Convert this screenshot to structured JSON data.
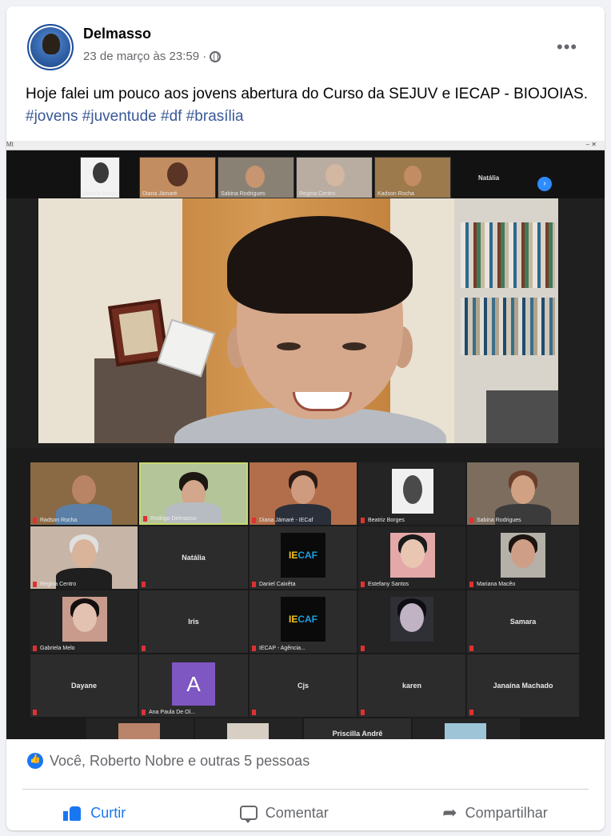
{
  "post": {
    "author": "Delmasso",
    "timestamp": "23 de março às 23:59 ·",
    "more_label": "•••",
    "text_before": "Hoje falei um pouco aos jovens abertura do Curso da SEJUV e IECAP - BIOJOIAS.",
    "hashtags": [
      "#jovens",
      "#juventude",
      "#df",
      "#brasília"
    ]
  },
  "media": {
    "window_title": "Mt",
    "window_controls": "–   ✕",
    "strip_tiles": [
      {
        "name": "Beatriz Borges"
      },
      {
        "name": "Diana Jámaré"
      },
      {
        "name": "Sabina Rodrigues"
      },
      {
        "name": "Regina Centro"
      },
      {
        "name": "Kadson Rocha"
      }
    ],
    "strip_label": "Natália",
    "strip_next": "›",
    "grid_tiles": [
      {
        "name": "Radson Rocha",
        "kind": "photo"
      },
      {
        "name": "Rodrigo Delmasso",
        "kind": "photo"
      },
      {
        "name": "Diana Jámaré - IECaf",
        "kind": "photo"
      },
      {
        "name": "Beatriz Borges",
        "kind": "photo"
      },
      {
        "name": "Sabina Rodrigues",
        "kind": "photo"
      },
      {
        "name": "Regina Centro",
        "kind": "photo"
      },
      {
        "name": "",
        "label": "Natália",
        "kind": "name"
      },
      {
        "name": "Daniel Caixêta",
        "kind": "logo"
      },
      {
        "name": "Estefany Santos",
        "kind": "photo"
      },
      {
        "name": "Mariana Macêo",
        "kind": "photo"
      },
      {
        "name": "Gabriela Melo",
        "kind": "photo"
      },
      {
        "name": "",
        "label": "Iris",
        "kind": "name"
      },
      {
        "name": "IECAP - Agência...",
        "kind": "logo"
      },
      {
        "name": "",
        "kind": "photo"
      },
      {
        "name": "",
        "label": "Samara",
        "kind": "name"
      },
      {
        "name": "",
        "label": "Dayane",
        "kind": "name"
      },
      {
        "name": "Ana Paula De Ol...",
        "kind": "letter",
        "letter": "A"
      },
      {
        "name": "",
        "label": "Cjs",
        "kind": "name"
      },
      {
        "name": "",
        "label": "karen",
        "kind": "name"
      },
      {
        "name": "",
        "label": "Janaína Machado",
        "kind": "name"
      },
      {
        "name": "",
        "kind": "photo"
      },
      {
        "name": "",
        "kind": "photo"
      },
      {
        "name": "",
        "label": "Priscilla Andrê",
        "kind": "name"
      },
      {
        "name": "",
        "kind": "photo"
      }
    ],
    "logo_text_a": "IE",
    "logo_text_b": "CAF"
  },
  "reactions": {
    "summary": "Você, Roberto Nobre e outras 5 pessoas"
  },
  "actions": {
    "like": "Curtir",
    "comment": "Comentar",
    "share": "Compartilhar"
  },
  "colors": {
    "brand": "#1877f2",
    "hashtag": "#385898",
    "meta": "#65676b"
  }
}
